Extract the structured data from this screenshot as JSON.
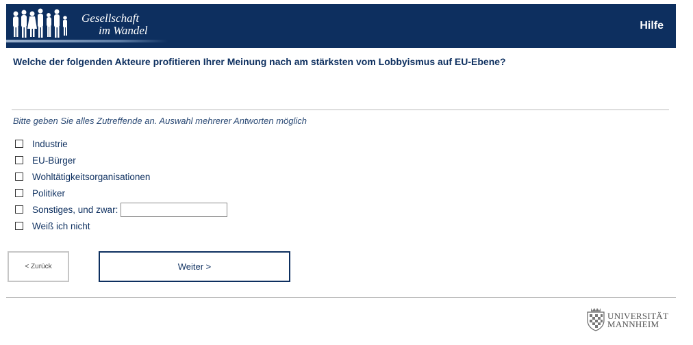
{
  "header": {
    "logo_line1": "Gesellschaft",
    "logo_line2": "im Wandel",
    "help_label": "Hilfe"
  },
  "question": "Welche der folgenden Akteure profitieren Ihrer Meinung nach am stärksten vom Lobbyismus auf EU-Ebene?",
  "instruction": "Bitte geben Sie alles Zutreffende an. Auswahl mehrerer Antworten möglich",
  "options": [
    {
      "label": "Industrie",
      "checked": false
    },
    {
      "label": "EU-Bürger",
      "checked": false
    },
    {
      "label": "Wohltätigkeitsorganisationen",
      "checked": false
    },
    {
      "label": "Politiker",
      "checked": false
    },
    {
      "label": "Sonstiges, und zwar:",
      "checked": false,
      "text_value": ""
    },
    {
      "label": "Weiß ich nicht",
      "checked": false
    }
  ],
  "nav": {
    "back_label": "< Zurück",
    "next_label": "Weiter >"
  },
  "footer": {
    "uni_line1": "UNIVERSITÄT",
    "uni_line2": "MANNHEIM"
  },
  "colors": {
    "brand_navy": "#0d2f5f",
    "text_blue": "#2b4a75"
  }
}
